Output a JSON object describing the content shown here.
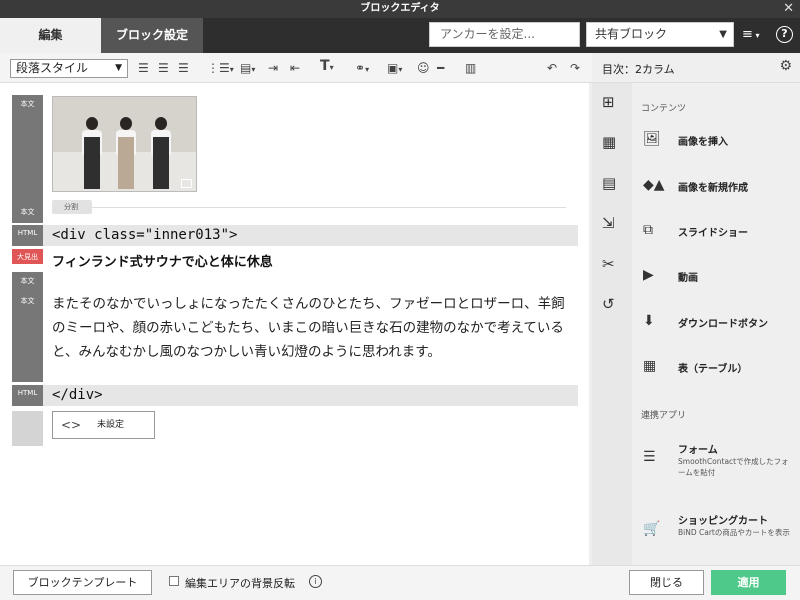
{
  "window": {
    "title": "ブロックエディタ"
  },
  "tabs": [
    {
      "label": "編集"
    },
    {
      "label": "ブロック設定"
    }
  ],
  "header": {
    "anchor_placeholder": "アンカーを設定...",
    "shared_block": "共有ブロック",
    "menu_label": "≡",
    "help_label": "?"
  },
  "toolbar": {
    "paragraph_style": "段落スタイル",
    "icons": [
      "align-left-icon",
      "align-center-icon",
      "align-right-icon",
      "list-icon",
      "block-icon",
      "indent-icon",
      "outdent-icon",
      "text-format-icon",
      "link-icon",
      "image-icon",
      "emoji-icon",
      "horizontal-rule-icon",
      "column-icon",
      "undo-icon",
      "redo-icon"
    ]
  },
  "editor": {
    "labels": {
      "body": "本文",
      "html": "HTML",
      "heading": "大見出"
    },
    "split_label": "分割",
    "html_open": "<div class=\"inner013\">",
    "heading_text": "フィンランド式サウナで心と体に休息",
    "paragraph_text": "またそのなかでいっしょになったたくさんのひとたち、ファゼーロとロザーロ、羊飼のミーロや、顔の赤いこどもたち、いまこの暗い巨きな石の建物のなかで考えていると、みんなむかし風のなつかしい青い幻燈のように思われます。",
    "html_close": "</div>",
    "unset_label": "未設定"
  },
  "sidebar": {
    "title": "目次：2カラム",
    "section_contents": "コンテンツ",
    "items": [
      {
        "label": "画像を挿入",
        "icon": "image-icon"
      },
      {
        "label": "画像を新規作成",
        "icon": "shapes-icon"
      },
      {
        "label": "スライドショー",
        "icon": "slideshow-icon"
      },
      {
        "label": "動画",
        "icon": "video-icon"
      },
      {
        "label": "ダウンロードボタン",
        "icon": "download-icon"
      },
      {
        "label": "表（テーブル）",
        "icon": "table-icon"
      }
    ],
    "section_apps": "連携アプリ",
    "apps": [
      {
        "label": "フォーム",
        "desc": "SmoothContactで作成したフォームを貼付",
        "icon": "form-icon"
      },
      {
        "label": "ショッピングカート",
        "desc": "BiND Cartの商品やカートを表示",
        "icon": "cart-icon"
      }
    ]
  },
  "footer": {
    "template_button": "ブロックテンプレート",
    "bg_toggle_label": "編集エリアの背景反転",
    "close_button": "閉じる",
    "apply_button": "適用"
  }
}
